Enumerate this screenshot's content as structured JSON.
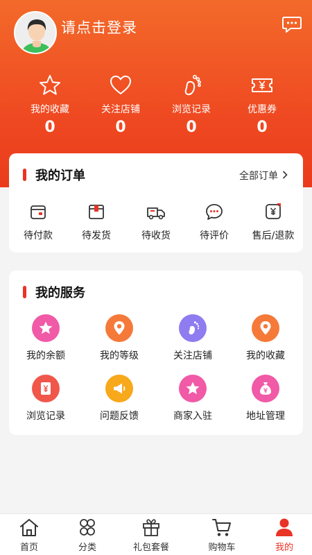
{
  "header": {
    "login_text": "请点击登录"
  },
  "stats": [
    {
      "label": "我的收藏",
      "count": "0",
      "icon": "star-icon"
    },
    {
      "label": "关注店铺",
      "count": "0",
      "icon": "heart-icon"
    },
    {
      "label": "浏览记录",
      "count": "0",
      "icon": "footprint-icon"
    },
    {
      "label": "优惠券",
      "count": "0",
      "icon": "coupon-icon"
    }
  ],
  "orders": {
    "title": "我的订单",
    "all_label": "全部订单",
    "items": [
      {
        "label": "待付款",
        "icon": "wallet-icon"
      },
      {
        "label": "待发货",
        "icon": "package-icon"
      },
      {
        "label": "待收货",
        "icon": "truck-icon"
      },
      {
        "label": "待评价",
        "icon": "comment-icon"
      },
      {
        "label": "售后/退款",
        "icon": "refund-icon"
      }
    ]
  },
  "services": {
    "title": "我的服务",
    "items": [
      {
        "label": "我的余额",
        "icon": "star-badge-icon",
        "color": "#f05aa7"
      },
      {
        "label": "我的等级",
        "icon": "location-pin-icon",
        "color": "#f57a3a"
      },
      {
        "label": "关注店铺",
        "icon": "footprint-icon",
        "color": "#8e7cf0"
      },
      {
        "label": "我的收藏",
        "icon": "location-pin-icon",
        "color": "#f57a3a"
      },
      {
        "label": "浏览记录",
        "icon": "yen-ticket-icon",
        "color": "#f0574a"
      },
      {
        "label": "问题反馈",
        "icon": "megaphone-icon",
        "color": "#f7a81b"
      },
      {
        "label": "商家入驻",
        "icon": "star-badge-icon",
        "color": "#f05aa7"
      },
      {
        "label": "地址管理",
        "icon": "money-bag-icon",
        "color": "#f05aa7"
      }
    ]
  },
  "tabbar": {
    "items": [
      {
        "label": "首页",
        "icon": "home-icon"
      },
      {
        "label": "分类",
        "icon": "category-icon"
      },
      {
        "label": "礼包套餐",
        "icon": "gift-icon"
      },
      {
        "label": "购物车",
        "icon": "cart-icon"
      },
      {
        "label": "我的",
        "icon": "user-icon"
      }
    ],
    "active_index": 4,
    "active_color": "#e93324"
  },
  "colors": {
    "brand_gradient_top": "#f36a2a",
    "brand_gradient_bottom": "#ea3b1c",
    "accent": "#e93324"
  }
}
